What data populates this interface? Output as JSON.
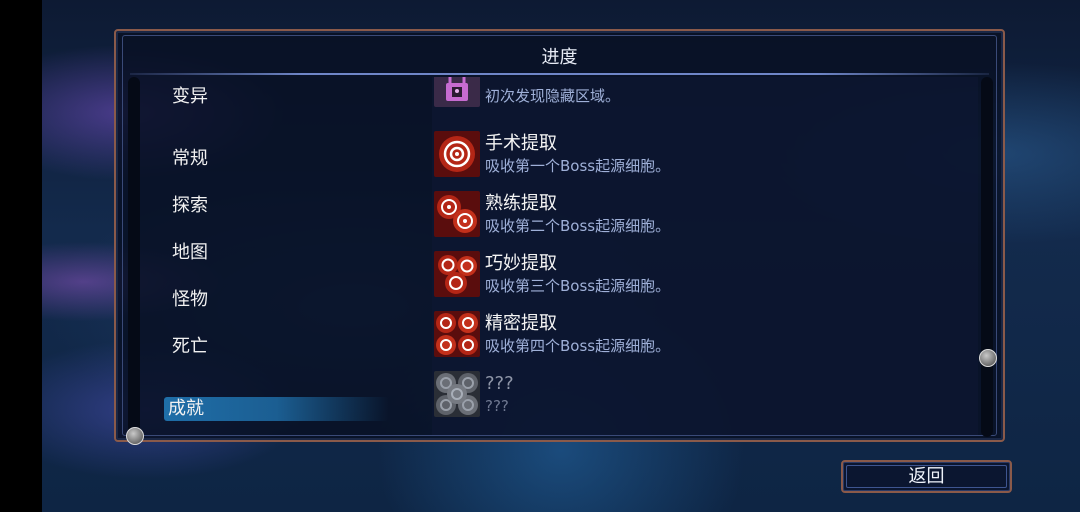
{
  "panel": {
    "title": "进度"
  },
  "categories": [
    {
      "label": "变异",
      "selected": false
    },
    {
      "label": "常规",
      "selected": false
    },
    {
      "label": "探索",
      "selected": false
    },
    {
      "label": "地图",
      "selected": false
    },
    {
      "label": "怪物",
      "selected": false
    },
    {
      "label": "死亡",
      "selected": false
    },
    {
      "label": "成就",
      "selected": true
    }
  ],
  "achievements": [
    {
      "name": "",
      "desc": "初次发现隐藏区域。",
      "icon": "lock-icon",
      "locked": false
    },
    {
      "name": "手术提取",
      "desc": "吸收第一个Boss起源细胞。",
      "icon": "cell-icon-1",
      "locked": false
    },
    {
      "name": "熟练提取",
      "desc": "吸收第二个Boss起源细胞。",
      "icon": "cell-icon-2",
      "locked": false
    },
    {
      "name": "巧妙提取",
      "desc": "吸收第三个Boss起源细胞。",
      "icon": "cell-icon-3",
      "locked": false
    },
    {
      "name": "精密提取",
      "desc": "吸收第四个Boss起源细胞。",
      "icon": "cell-icon-4",
      "locked": false
    },
    {
      "name": "???",
      "desc": "???",
      "icon": "cell-icon-5",
      "locked": true
    }
  ],
  "buttons": {
    "back": "返回"
  },
  "colors": {
    "accent": "#1f6ea8",
    "frame": "#8a5a4a",
    "cell_red": "#e2432f"
  }
}
